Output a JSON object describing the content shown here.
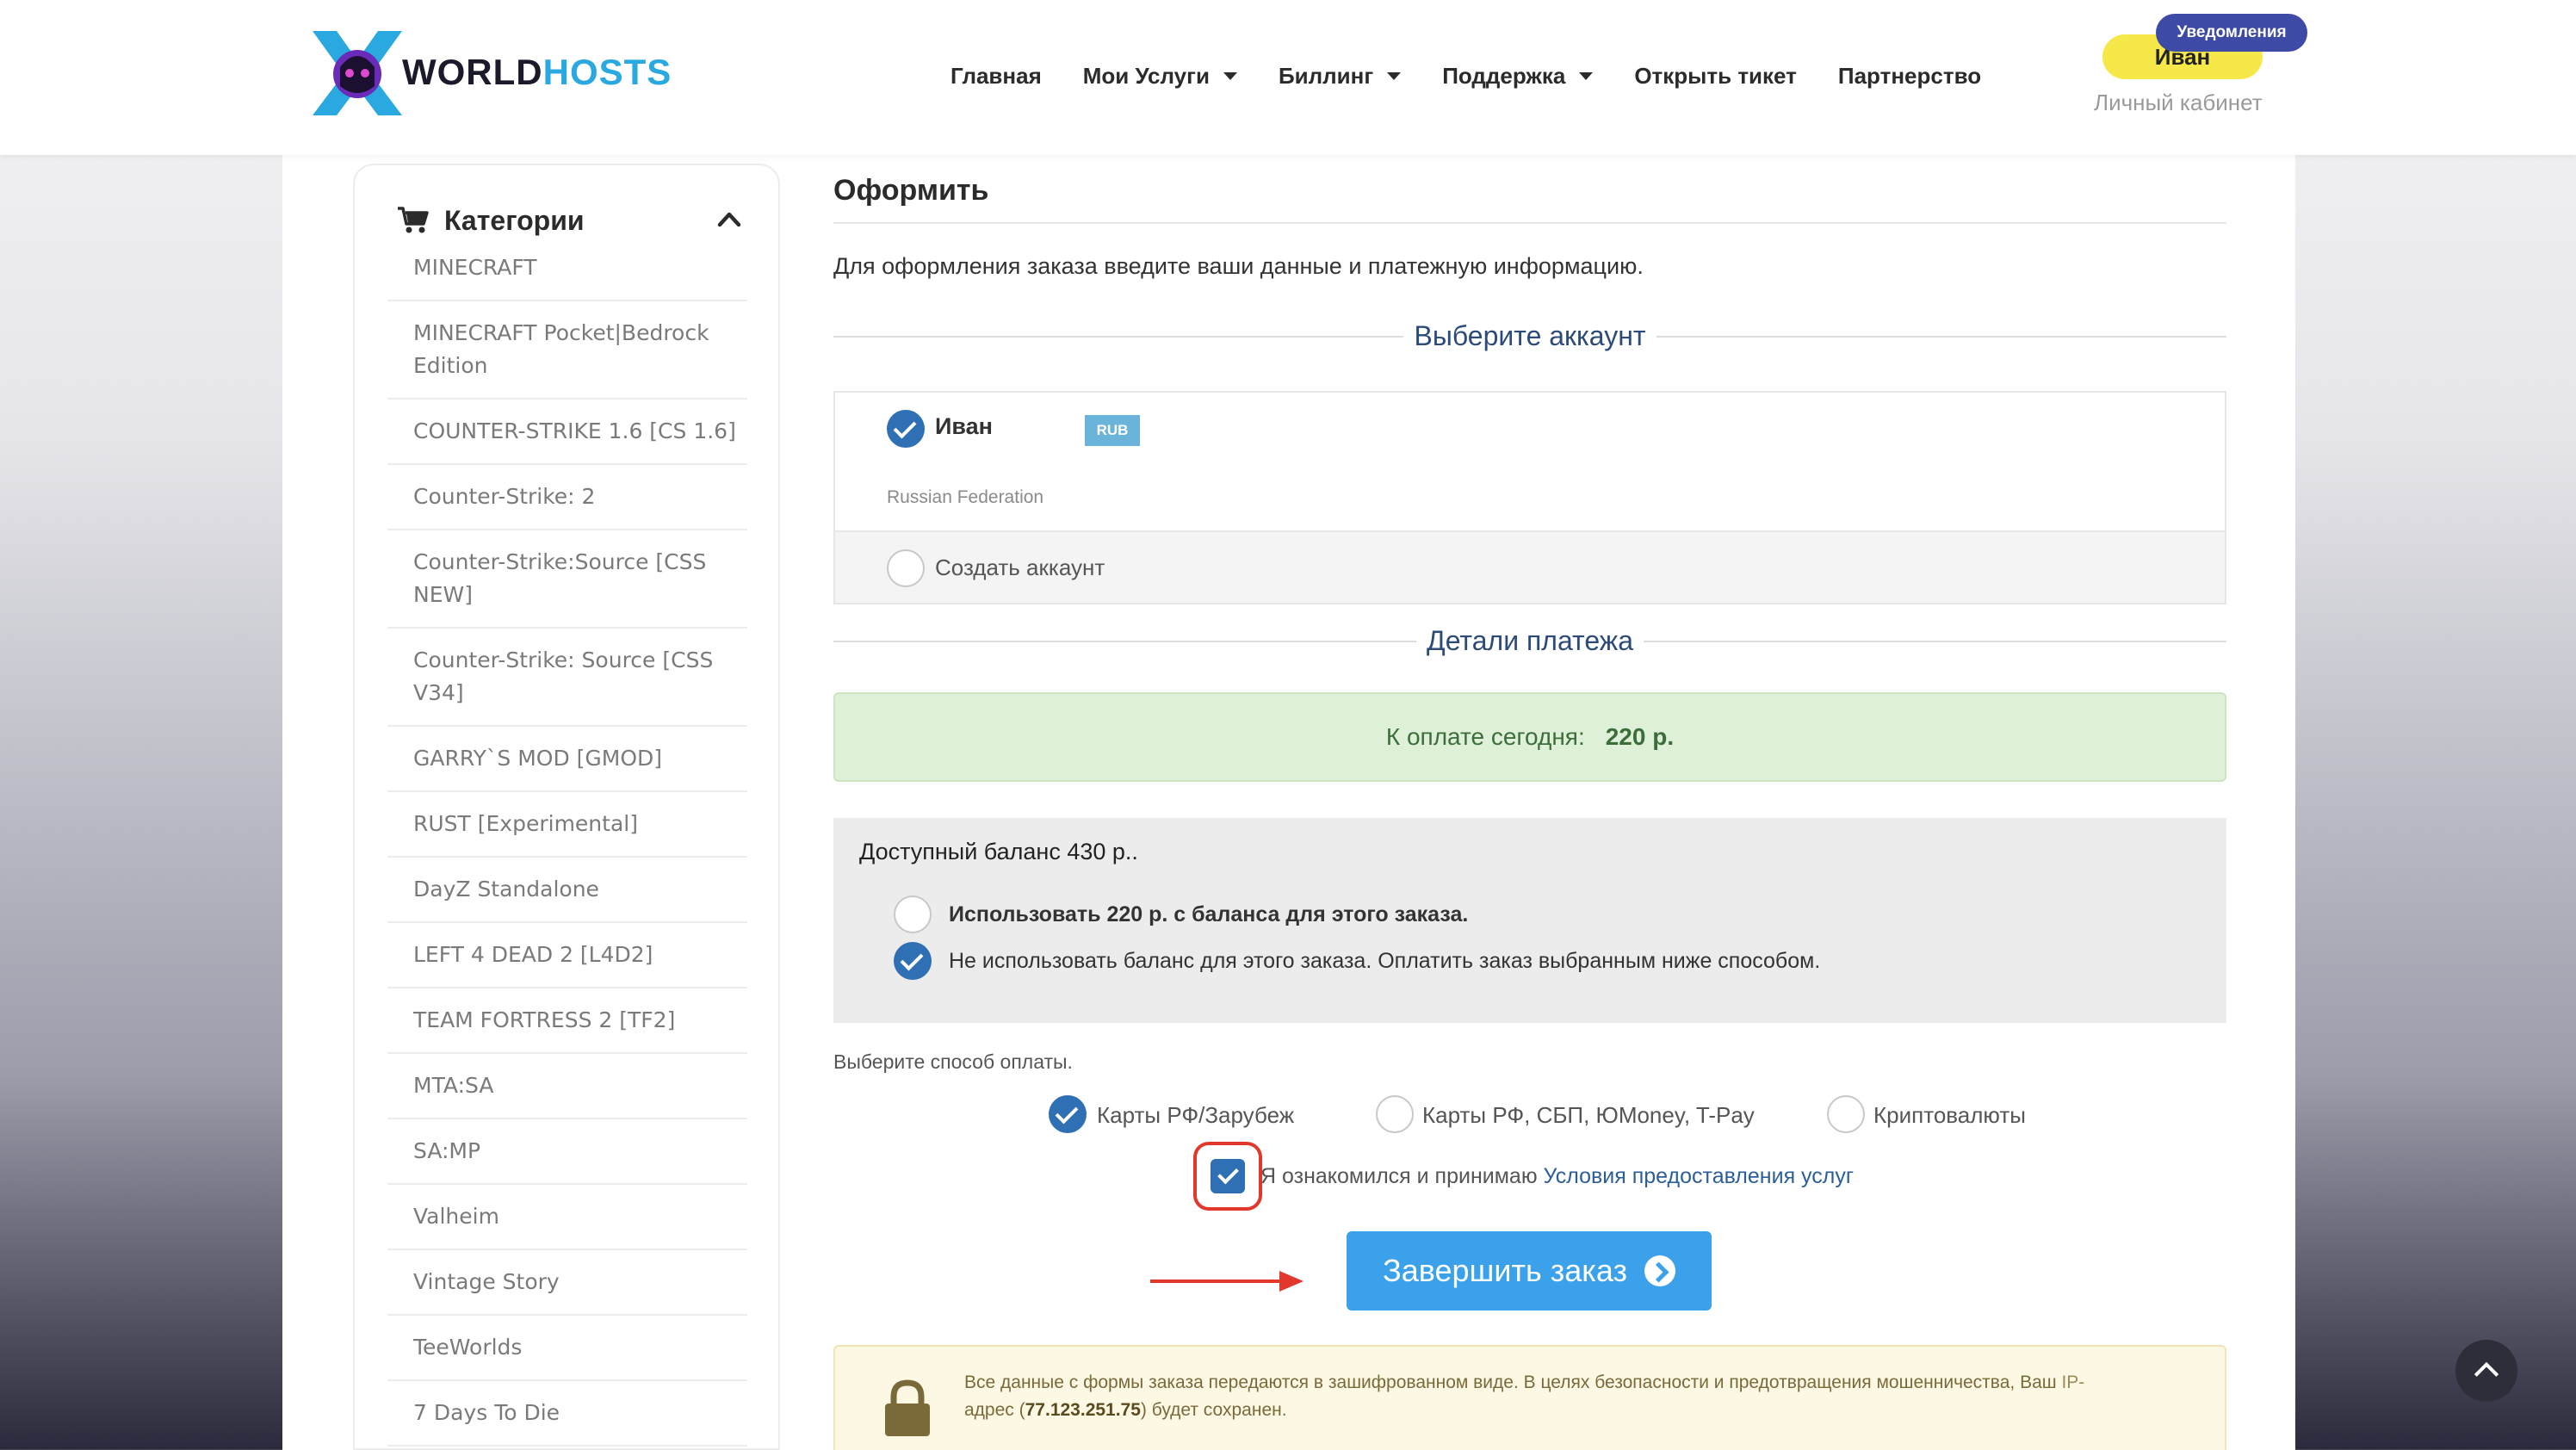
{
  "header": {
    "logo_word1": "WORLD",
    "logo_word2": "HOSTS",
    "nav": [
      {
        "label": "Главная",
        "dropdown": false
      },
      {
        "label": "Мои Услуги",
        "dropdown": true
      },
      {
        "label": "Биллинг",
        "dropdown": true
      },
      {
        "label": "Поддержка",
        "dropdown": true
      },
      {
        "label": "Открыть тикет",
        "dropdown": false
      },
      {
        "label": "Партнерство",
        "dropdown": false
      }
    ],
    "user_name": "Иван",
    "notifications_label": "Уведомления",
    "cabinet_label": "Личный кабинет"
  },
  "sidebar": {
    "title": "Категории",
    "categories": [
      "MINECRAFT",
      "MINECRAFT Pocket|Bedrock Edition",
      "COUNTER-STRIKE 1.6 [CS 1.6]",
      "Counter-Strike: 2",
      "Counter-Strike:Source [CSS NEW]",
      "Counter-Strike: Source [CSS V34]",
      "GARRY`S MOD [GMOD]",
      "RUST [Experimental]",
      "DayZ Standalone",
      "LEFT 4 DEAD 2 [L4D2]",
      "TEAM FORTRESS 2 [TF2]",
      "MTA:SA",
      "SA:MP",
      "Valheim",
      "Vintage Story",
      "TeeWorlds",
      "7 Days To Die"
    ]
  },
  "checkout": {
    "title": "Оформить",
    "intro": "Для оформления заказа введите ваши данные и платежную информацию.",
    "account_section_title": "Выберите аккаунт",
    "account": {
      "name": "Иван",
      "currency_badge": "RUB",
      "country": "Russian Federation",
      "selected": true
    },
    "create_account_label": "Создать аккаунт",
    "payment_section_title": "Детали платежа",
    "due_today_label": "К оплате сегодня:",
    "due_today_amount": "220 р.",
    "balance_label": "Доступный баланс",
    "balance_amount": "430 р..",
    "balance_options": [
      {
        "label": "Использовать 220 р. с баланса для этого заказа.",
        "selected": false,
        "bold": true
      },
      {
        "label": "Не использовать баланс для этого заказа. Оплатить заказ выбранным ниже способом.",
        "selected": true,
        "bold": false
      }
    ],
    "payment_method_label": "Выберите способ оплаты.",
    "payment_methods": [
      {
        "label": "Карты РФ/Зарубеж",
        "selected": true
      },
      {
        "label": "Карты РФ, СБП, ЮMoney, T-Pay",
        "selected": false
      },
      {
        "label": "Криптовалюты",
        "selected": false
      }
    ],
    "tos_prefix": "Я ознакомился и принимаю",
    "tos_link": "Условия предоставления услуг",
    "tos_checked": true,
    "submit_label": "Завершить заказ",
    "security_text_1": "Все данные с формы заказа передаются в зашифрованном виде. В целях безопасности и предотвращения мошенничества, Ваш",
    "security_ip_word": "IP-",
    "security_text_2": "адрес (",
    "ip_address": "77.123.251.75",
    "security_text_3": ") будет сохранен."
  },
  "colors": {
    "accent_blue": "#2f6fb4",
    "button_blue": "#3ba1ea",
    "highlight_red": "#e2382c",
    "user_pill_yellow": "#f7e84a",
    "notif_badge": "#3d4aa6"
  }
}
